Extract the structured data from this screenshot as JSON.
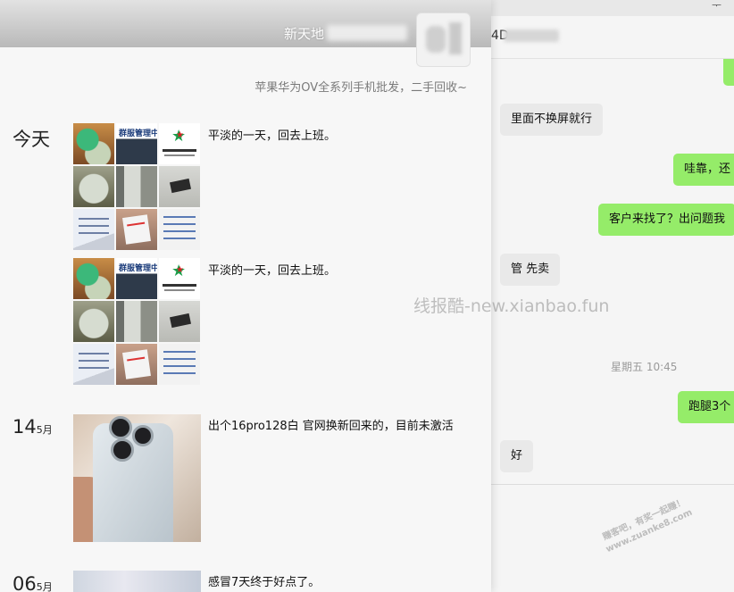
{
  "window": {
    "control_glyph": "ᅮ"
  },
  "chat": {
    "name_partial": "4D",
    "messages": [
      {
        "dir": "out",
        "text": ""
      },
      {
        "dir": "in",
        "text": "里面不换屏就行"
      },
      {
        "dir": "out",
        "text": "哇靠，还"
      },
      {
        "dir": "out",
        "text": "客户来找了？出问题我"
      },
      {
        "dir": "in",
        "text": "管 先卖"
      },
      {
        "dir": "out",
        "text": "跑腿3个"
      },
      {
        "dir": "in",
        "text": "好"
      }
    ],
    "timestamp": "星期五 10:45"
  },
  "watermarks": {
    "site": "线报酷-new.xianbao.fun",
    "corner_line1": "赚客吧，有奖一起赚！",
    "corner_line2": "www.zuanke8.com"
  },
  "moments": {
    "nickname_partial": "新天地",
    "signature": "苹果华为OV全系列手机批发，二手回收~",
    "posts": [
      {
        "date_label": "今天",
        "day": "",
        "month": "",
        "text": "平淡的一天，回去上班。"
      },
      {
        "date_label": "",
        "day": "",
        "month": "",
        "text": "平淡的一天，回去上班。"
      },
      {
        "date_label": "",
        "day": "14",
        "month": "5月",
        "text": "出个16pro128白 官网换新回来的，目前未激活"
      },
      {
        "date_label": "",
        "day": "06",
        "month": "5月",
        "text": "感冒7天终于好点了。"
      }
    ],
    "grid_image_labels": {
      "sign_text": "群服管理中"
    }
  }
}
